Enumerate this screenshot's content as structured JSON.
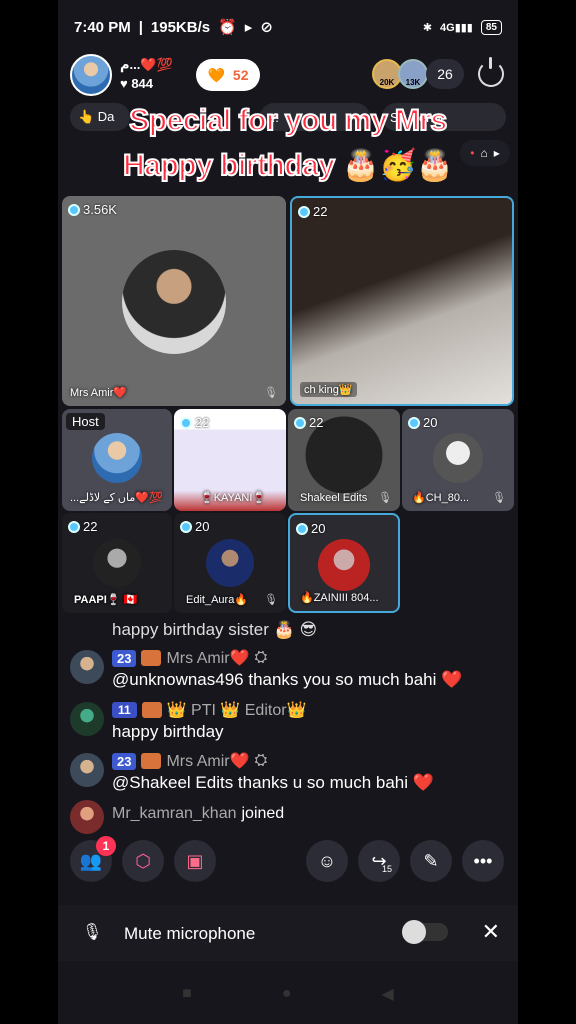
{
  "status": {
    "time": "7:40 PM",
    "speed": "195KB/s",
    "battery": "85"
  },
  "header": {
    "host_name": "م...❤️💯",
    "host_likes": "♥ 844",
    "like_count": "52",
    "viewer1_level": "20K",
    "viewer2_level": "13K",
    "viewer_count": "26"
  },
  "tags": [
    "👆 Da",
    "...",
    "S... lleng"
  ],
  "overlay": {
    "line1": "Special for you my Mrs",
    "line2": "Happy birthday 🎂🥳🎂"
  },
  "seats": {
    "main_left": {
      "count": "3.56K",
      "label": "Mrs Amir❤️"
    },
    "main_right": {
      "count": "22",
      "label": "ch king👑"
    },
    "host": {
      "tag": "Host",
      "label": "...ماں کے لاڈلے❤️💯"
    },
    "s2": {
      "count": "22",
      "label": "🍷KAYANI🍷"
    },
    "s3": {
      "count": "22",
      "label": "Shakeel Edits"
    },
    "s4": {
      "count": "20",
      "label": "🔥CH_80..."
    },
    "s5": {
      "count": "22",
      "label": "PAAPI🍷 🇨🇦"
    },
    "s6": {
      "count": "20",
      "label": "Edit_Aura🔥"
    },
    "s7": {
      "count": "20",
      "label": "🔥ZAINIII 804..."
    }
  },
  "chat": {
    "m0": {
      "text": "happy birthday sister 🎂 😎"
    },
    "m1": {
      "level": "23",
      "name": "Mrs Amir❤️",
      "text": "@unknownas496 thanks you so much bahi ❤️"
    },
    "m2": {
      "level": "11",
      "name": "👑 PTI 👑 Editor👑",
      "text": "happy birthday"
    },
    "m3": {
      "level": "23",
      "name": "Mrs Amir❤️",
      "text": "@Shakeel Edits thanks u so much bahi ❤️"
    },
    "m4": {
      "name": "Mr_kamran_khan",
      "suffix": "joined"
    }
  },
  "toolbar": {
    "friends_badge": "1",
    "share_count": "15"
  },
  "mute": {
    "label": "Mute microphone"
  }
}
